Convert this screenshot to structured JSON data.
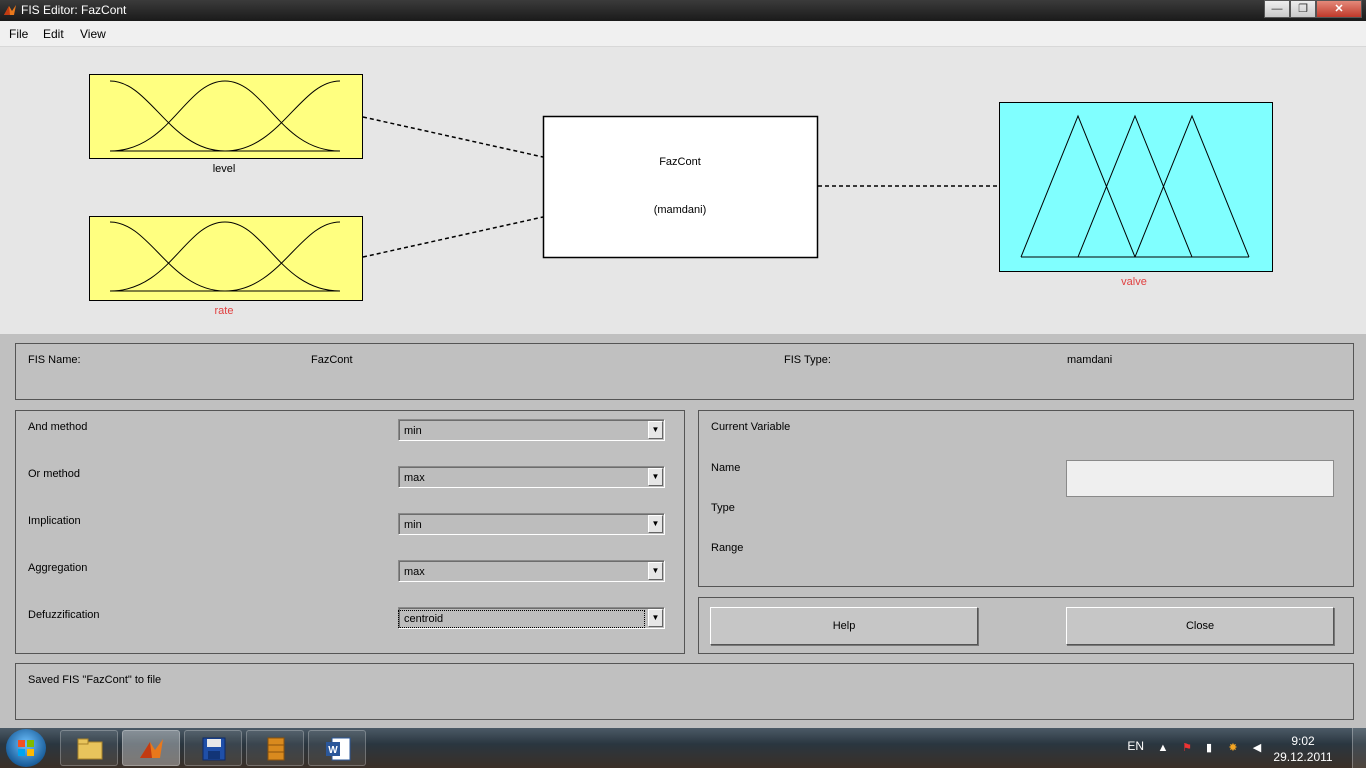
{
  "window": {
    "title": "FIS Editor: FazCont",
    "minimize_label": "—",
    "maximize_label": "❐",
    "close_label": "✕"
  },
  "menu": {
    "items": [
      "File",
      "Edit",
      "View"
    ]
  },
  "diagram": {
    "inputs": [
      {
        "name": "level",
        "label_color": "#000000",
        "fill": "#ffff80"
      },
      {
        "name": "rate",
        "label_color": "#e04040",
        "fill": "#ffff80"
      }
    ],
    "system": {
      "name": "FazCont",
      "type": "(mamdani)"
    },
    "output": {
      "name": "valve",
      "label_color": "#e04040",
      "fill": "#80ffff"
    }
  },
  "fis_info": {
    "name_label": "FIS Name:",
    "name_value": "FazCont",
    "type_label": "FIS Type:",
    "type_value": "mamdani"
  },
  "methods": [
    {
      "label": "And method",
      "value": "min"
    },
    {
      "label": "Or method",
      "value": "max"
    },
    {
      "label": "Implication",
      "value": "min"
    },
    {
      "label": "Aggregation",
      "value": "max"
    },
    {
      "label": "Defuzzification",
      "value": "centroid"
    }
  ],
  "current_variable": {
    "title": "Current Variable",
    "name_label": "Name",
    "name_value": "",
    "type_label": "Type",
    "range_label": "Range"
  },
  "buttons": {
    "help": "Help",
    "close": "Close"
  },
  "status": {
    "message": "Saved FIS \"FazCont\" to file"
  },
  "taskbar": {
    "language": "EN",
    "time": "9:02",
    "date": "29.12.2011",
    "apps": [
      "windows-explorer",
      "matlab",
      "save-disk",
      "archive-books",
      "microsoft-word"
    ]
  }
}
